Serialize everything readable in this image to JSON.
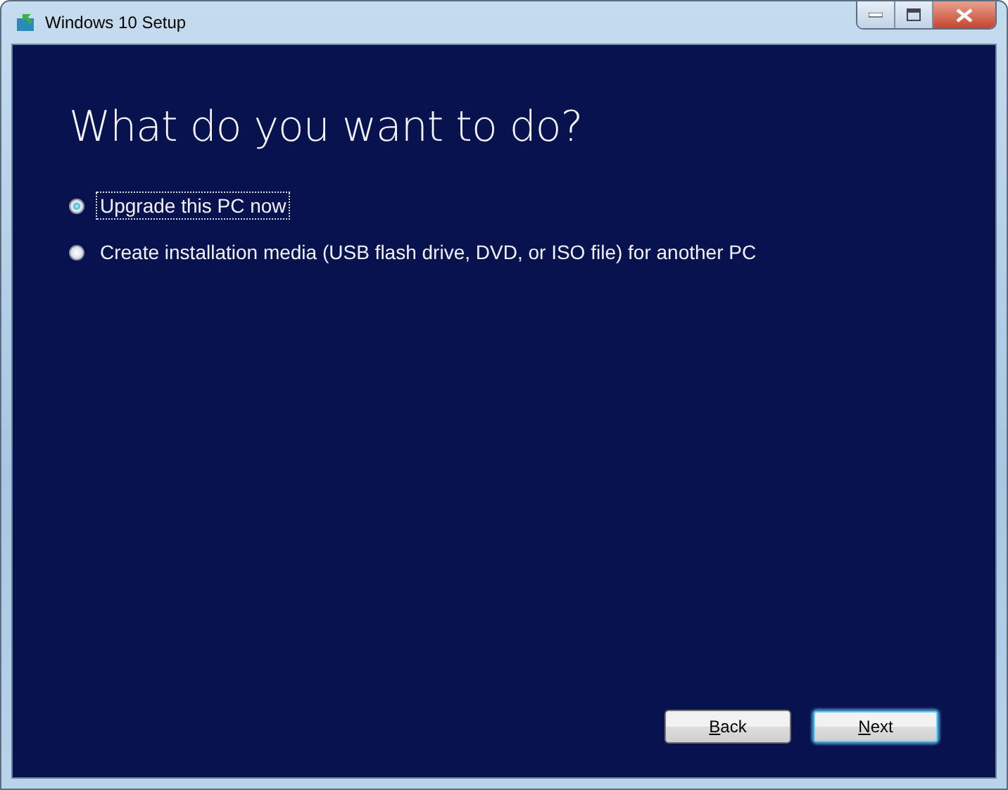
{
  "window": {
    "title": "Windows 10 Setup"
  },
  "heading": "What do you want to do?",
  "options": [
    {
      "label": "Upgrade this PC now",
      "selected": true
    },
    {
      "label": "Create installation media (USB flash drive, DVD, or ISO file) for another PC",
      "selected": false
    }
  ],
  "buttons": [
    {
      "label": "Back",
      "default": false
    },
    {
      "label": "Next",
      "default": true
    }
  ]
}
